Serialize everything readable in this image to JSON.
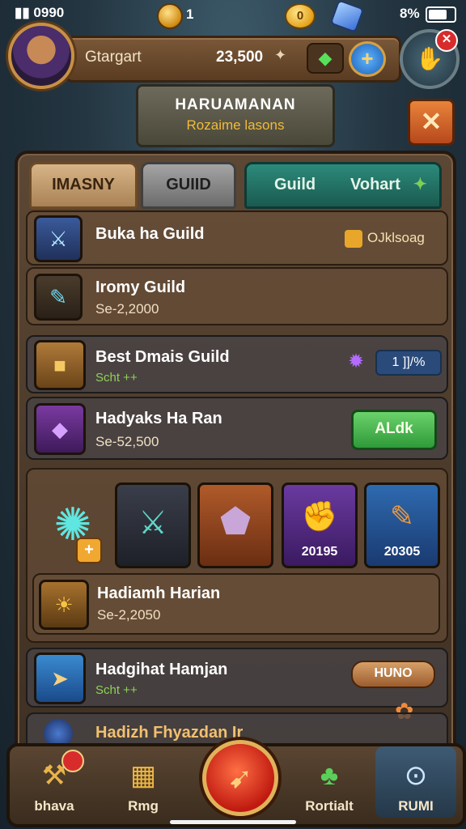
{
  "status": {
    "signal": "▮▮ 0990",
    "gems": "1",
    "coin_label": "0",
    "battery_pct": "8%"
  },
  "header": {
    "player_name": "Gtargart",
    "score": "23,500",
    "spark": "✦",
    "plus": "+"
  },
  "title": {
    "main": "HARUAMANAN",
    "sub": "Rozaime lasons"
  },
  "tabs": {
    "tab1": "IMASNY",
    "tab2": "GUIID",
    "tab3_a": "Guild",
    "tab3_b": "Vohart"
  },
  "guilds": [
    {
      "name": "Buka ha Guild",
      "badge": "OJklsoag"
    },
    {
      "name": "Iromy Guild",
      "sub": "Se-2,2000"
    },
    {
      "name": "Best Dmais Guild",
      "sub": "Scht ++",
      "badge": "1 ]]/%"
    },
    {
      "name": "Hadyaks Ha Ran",
      "sub": "Se-52,500",
      "action": "ALdk"
    },
    {
      "name": "Hadiamh Harian",
      "sub": "Se-2,2050"
    },
    {
      "name": "Hadgihat Hamjan",
      "sub": "Scht ++",
      "action": "HUNO"
    },
    {
      "name": "Hadizh Fhyazdan Ir"
    }
  ],
  "tiles": {
    "tile4_count": "20195",
    "tile5_count": "20305",
    "plus": "+"
  },
  "nav": [
    {
      "label": "bhava"
    },
    {
      "label": "Rmg"
    },
    {
      "label": "Rortialt"
    },
    {
      "label": "RUMI"
    }
  ],
  "colors": {
    "accent_gold": "#e0b25a",
    "action_green": "#2f9a3a",
    "close_orange": "#e8843a",
    "alert_red": "#d82c2c"
  }
}
